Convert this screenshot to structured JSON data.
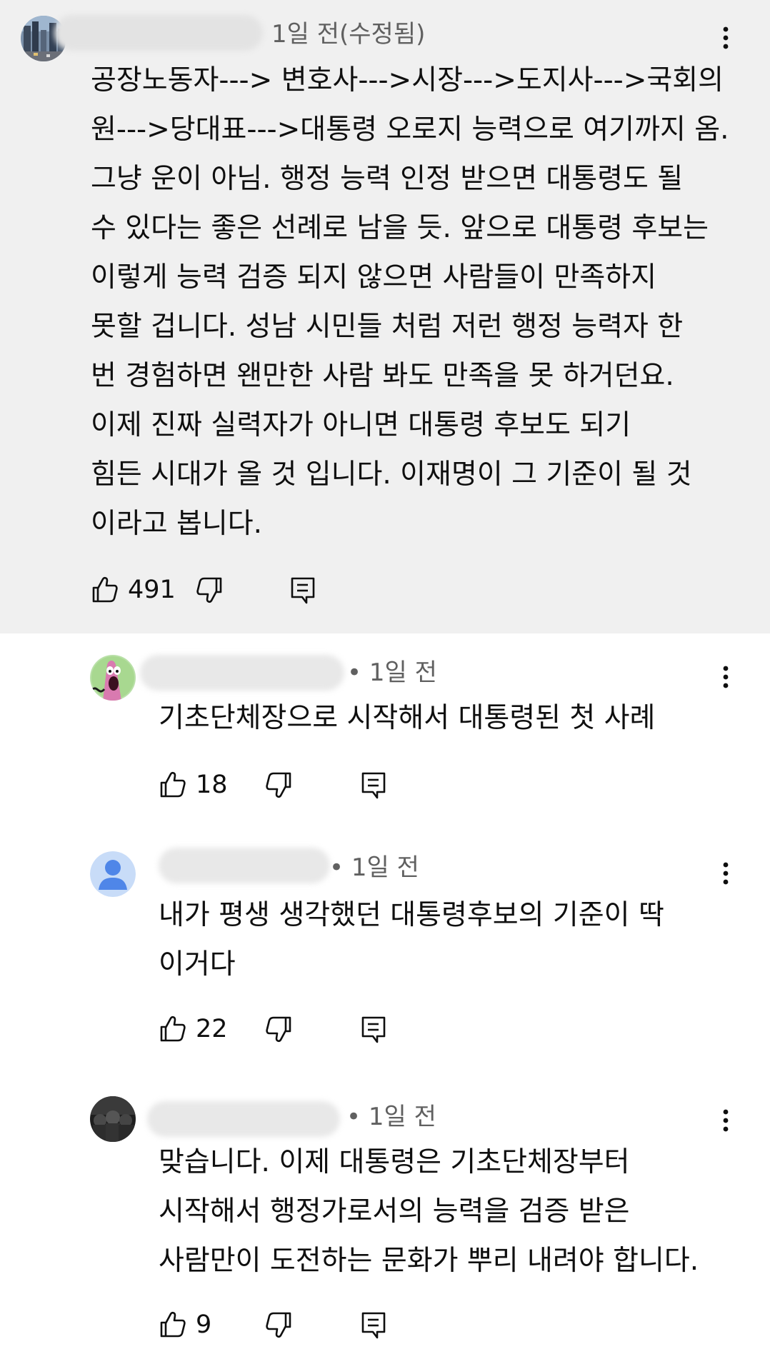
{
  "comments": [
    {
      "meta": "1일 전(수정됨)",
      "lines": [
        "공장노동자---> 변호사--->시장--->도지사--->국회의",
        "원--->당대표--->대통령 오로지 능력으로 여기까지 옴.",
        "그냥 운이 아님. 행정 능력 인정 받으면 대통령도 될",
        "수 있다는 좋은 선례로 남을 듯. 앞으로 대통령 후보는",
        "이렇게 능력 검증 되지 않으면 사람들이 만족하지",
        "못할 겁니다. 성남 시민들 처럼 저런 행정 능력자 한",
        "번 경험하면 왠만한 사람 봐도 만족을 못 하거던요.",
        "이제 진짜 실력자가 아니면 대통령 후보도 되기",
        "힘든 시대가 올 것 입니다. 이재명이 그 기준이 될 것",
        "이라고 봅니다."
      ],
      "likes": "491",
      "avatar_icon": "city-photo-avatar"
    },
    {
      "meta": "• 1일 전",
      "lines": [
        "기초단체장으로 시작해서 대통령된 첫 사례"
      ],
      "likes": "18",
      "avatar_icon": "cartoon-character-avatar"
    },
    {
      "meta": "• 1일 전",
      "lines": [
        "내가 평생 생각했던 대통령후보의 기준이 딱",
        "이거다"
      ],
      "likes": "22",
      "avatar_icon": "default-person-avatar"
    },
    {
      "meta": "• 1일 전",
      "lines": [
        "맞습니다. 이제 대통령은 기초단체장부터",
        "시작해서 행정가로서의 능력을 검증 받은",
        "사람만이 도전하는 문화가 뿌리 내려야 합니다."
      ],
      "likes": "9",
      "avatar_icon": "dark-photo-avatar"
    }
  ],
  "colors": {
    "main_comment_bg": "#f0f0f0",
    "default_avatar_blue": "#5a8ee6",
    "meta_gray": "#606060"
  },
  "icons": {
    "like": "thumbs-up-icon",
    "dislike": "thumbs-down-icon",
    "reply": "reply-icon",
    "more": "more-vert-icon"
  }
}
